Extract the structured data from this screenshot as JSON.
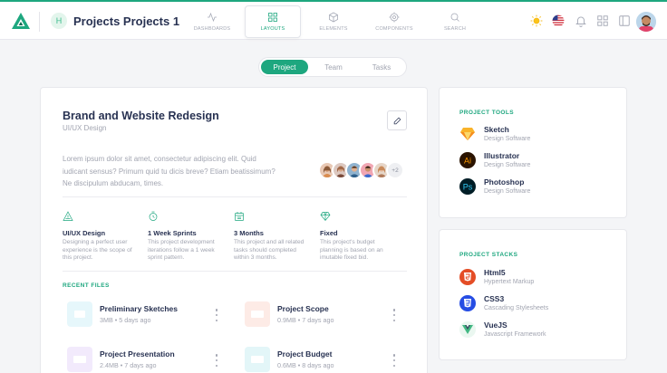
{
  "header": {
    "project_initial": "H",
    "project_title": "Projects Projects 1",
    "nav": [
      {
        "label": "DASHBOARDS",
        "icon": "activity-icon"
      },
      {
        "label": "LAYOUTS",
        "icon": "grid-icon",
        "active": true
      },
      {
        "label": "ELEMENTS",
        "icon": "box-icon"
      },
      {
        "label": "COMPONENTS",
        "icon": "settings-icon"
      },
      {
        "label": "SEARCH",
        "icon": "search-icon"
      }
    ]
  },
  "tabs": [
    "Project",
    "Team",
    "Tasks"
  ],
  "project": {
    "title": "Brand and Website Redesign",
    "subtitle": "UI/UX Design",
    "description": "Lorem ipsum dolor sit amet, consectetur adipiscing elit. Quid iudicant sensus? Primum quid tu dicis breve? Etiam beatissimum? Ne discipulum abducam, times.",
    "extra_members": "+2",
    "features": [
      {
        "title": "UI/UX Design",
        "text": "Designing a perfect user experience is the scope of this project.",
        "icon": "triangle-icon"
      },
      {
        "title": "1 Week Sprints",
        "text": "This project development iterations follow a 1 week sprint pattern.",
        "icon": "clock-icon"
      },
      {
        "title": "3 Months",
        "text": "This project and all related tasks should completed within 3 months.",
        "icon": "calendar-icon"
      },
      {
        "title": "Fixed",
        "text": "This project's budget planning is based on an imutable fixed bid.",
        "icon": "diamond-icon"
      }
    ],
    "recent_files_label": "RECENT FILES",
    "files": [
      {
        "name": "Preliminary Sketches",
        "size": "3MB",
        "age": "5 days ago",
        "type": "ZIP",
        "color": "#2bb7d3",
        "bg": "#e6f7fb"
      },
      {
        "name": "Project Scope",
        "size": "0.9MB",
        "age": "7 days ago",
        "type": "PDF",
        "color": "#ec6848",
        "bg": "#fdebe6"
      },
      {
        "name": "Project Presentation",
        "size": "2.4MB",
        "age": "7 days ago",
        "type": "PPT",
        "color": "#a36de0",
        "bg": "#f2eafc"
      },
      {
        "name": "Project Budget",
        "size": "0.6MB",
        "age": "8 days ago",
        "type": "XLS",
        "color": "#31b7c8",
        "bg": "#e3f6f8"
      }
    ]
  },
  "tools": {
    "label": "PROJECT TOOLS",
    "items": [
      {
        "name": "Sketch",
        "sub": "Design Software",
        "icon": "sketch-icon"
      },
      {
        "name": "Illustrator",
        "sub": "Design Software",
        "icon": "illustrator-icon"
      },
      {
        "name": "Photoshop",
        "sub": "Design Software",
        "icon": "photoshop-icon"
      }
    ]
  },
  "stacks": {
    "label": "PROJECT STACKS",
    "items": [
      {
        "name": "Html5",
        "sub": "Hypertext Markup",
        "icon": "html5-icon"
      },
      {
        "name": "CSS3",
        "sub": "Cascading Stylesheets",
        "icon": "css3-icon"
      },
      {
        "name": "VueJS",
        "sub": "Javascript Framework",
        "icon": "vuejs-icon"
      }
    ]
  },
  "colors": {
    "accent": "#1ea77f",
    "text": "#283252",
    "muted": "#a2a5b1"
  }
}
